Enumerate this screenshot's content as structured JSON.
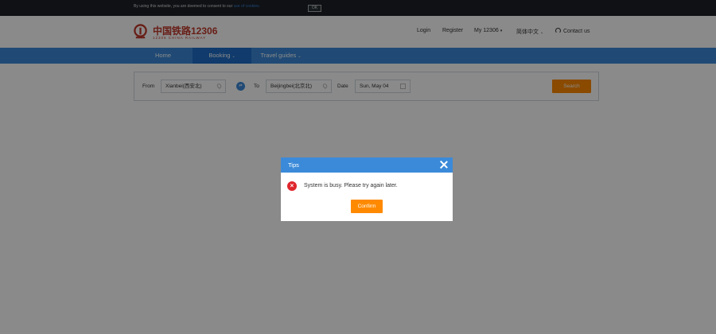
{
  "cookie_bar": {
    "text": "By using this website, you are deemed to consent to our",
    "link": "use of cookies.",
    "ok_label": "OK"
  },
  "header": {
    "logo_cn": "中国铁路12306",
    "logo_en": "12306 CHINA RAILWAY",
    "login": "Login",
    "register": "Register",
    "my12306": "My 12306",
    "language": "简体中文",
    "contact": "Contact us"
  },
  "nav": {
    "home": "Home",
    "booking": "Booking",
    "travel_guides": "Travel guides"
  },
  "search": {
    "from_label": "From",
    "from_value": "Xianbei(西安北)",
    "to_label": "To",
    "to_value": "Beijingbei(北京北)",
    "date_label": "Date",
    "date_value": "Sun, May 04",
    "search_button": "Search"
  },
  "dialog": {
    "title": "Tips",
    "message": "System is busy. Please try again later.",
    "confirm": "Confirm"
  },
  "colors": {
    "brand_red": "#c0392b",
    "nav_blue": "#3b8ad9",
    "accent_orange": "#ff8a00",
    "error_red": "#e0262d"
  }
}
